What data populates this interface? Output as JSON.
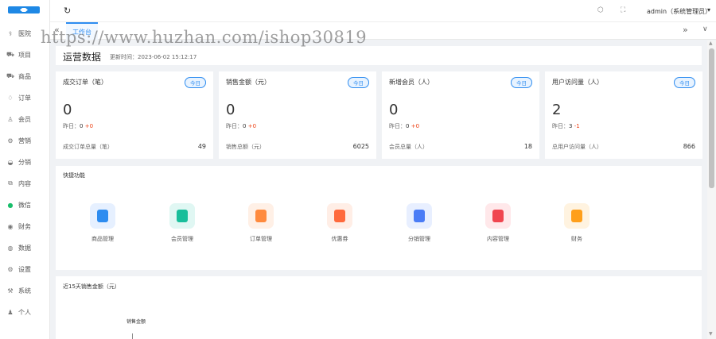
{
  "sidebar": {
    "items": [
      {
        "icon": "medical-icon",
        "glyph": "⚕",
        "label": "医院"
      },
      {
        "icon": "cart-icon",
        "glyph": "⛟",
        "label": "项目"
      },
      {
        "icon": "cart-icon",
        "glyph": "⛟",
        "label": "商品"
      },
      {
        "icon": "bell-icon",
        "glyph": "♢",
        "label": "订单"
      },
      {
        "icon": "user-icon",
        "glyph": "♙",
        "label": "会员"
      },
      {
        "icon": "gear-icon",
        "glyph": "⚙",
        "label": "营销"
      },
      {
        "icon": "layers-icon",
        "glyph": "◒",
        "label": "分销"
      },
      {
        "icon": "book-icon",
        "glyph": "⧉",
        "label": "内容"
      },
      {
        "icon": "wechat-icon",
        "glyph": "●",
        "label": "微信"
      },
      {
        "icon": "finance-icon",
        "glyph": "◉",
        "label": "财务"
      },
      {
        "icon": "data-icon",
        "glyph": "◍",
        "label": "数据"
      },
      {
        "icon": "settings-icon",
        "glyph": "⚙",
        "label": "设置"
      },
      {
        "icon": "system-icon",
        "glyph": "⚒",
        "label": "系统"
      },
      {
        "icon": "person-icon",
        "glyph": "♟",
        "label": "个人"
      }
    ]
  },
  "topbar": {
    "refresh_glyph": "↻",
    "tag_glyph": "⬡",
    "fullscreen_glyph": "⛶",
    "user": "admin（系统管理员）",
    "caret": "▾"
  },
  "tabs": {
    "left_glyph": "«",
    "active": "工作台",
    "right_glyph": "»",
    "down_glyph": "∨"
  },
  "watermark": "https://www.huzhan.com/ishop30819",
  "header": {
    "title": "运营数据",
    "update": "更新时间：2023-06-02 15:12:17"
  },
  "stats": [
    {
      "label": "成交订单（笔）",
      "badge": "今日",
      "value": "0",
      "yday_label": "昨日：",
      "yday_val": "0",
      "yday_delta": "+0",
      "total_label": "成交订单总量（笔）",
      "total": "49"
    },
    {
      "label": "销售金额（元）",
      "badge": "今日",
      "value": "0",
      "yday_label": "昨日：",
      "yday_val": "0",
      "yday_delta": "+0",
      "total_label": "销售总额（元）",
      "total": "6025"
    },
    {
      "label": "新增会员（人）",
      "badge": "今日",
      "value": "0",
      "yday_label": "昨日：",
      "yday_val": "0",
      "yday_delta": "+0",
      "total_label": "会员总量（人）",
      "total": "18"
    },
    {
      "label": "用户访问量（人）",
      "badge": "今日",
      "value": "2",
      "yday_label": "昨日：",
      "yday_val": "3",
      "yday_delta": "-1",
      "total_label": "总用户访问量（人）",
      "total": "866"
    }
  ],
  "quick": {
    "title": "快捷功能",
    "items": [
      {
        "label": "商品管理",
        "icon": "product-icon",
        "bg": "#e6f0ff",
        "fg": "#2d8cf0"
      },
      {
        "label": "会员管理",
        "icon": "members-icon",
        "bg": "#e0f7f3",
        "fg": "#19be9b"
      },
      {
        "label": "订单管理",
        "icon": "order-icon",
        "bg": "#fff0e6",
        "fg": "#ff8a3d"
      },
      {
        "label": "优惠券",
        "icon": "coupon-icon",
        "bg": "#ffeee6",
        "fg": "#ff6a3d"
      },
      {
        "label": "分销管理",
        "icon": "megaphone-icon",
        "bg": "#e8efff",
        "fg": "#4a7cf6"
      },
      {
        "label": "内容管理",
        "icon": "content-icon",
        "bg": "#ffe8ea",
        "fg": "#f0454f"
      },
      {
        "label": "财务",
        "icon": "finance-icon",
        "bg": "#fff3e0",
        "fg": "#ff9f1a"
      }
    ]
  },
  "chart": {
    "title": "近15天销售金额（元）",
    "series_name": "销售金额"
  },
  "colors": {
    "accent": "#2d8cf0",
    "red": "#ed4014",
    "wechat": "#19be6b"
  }
}
